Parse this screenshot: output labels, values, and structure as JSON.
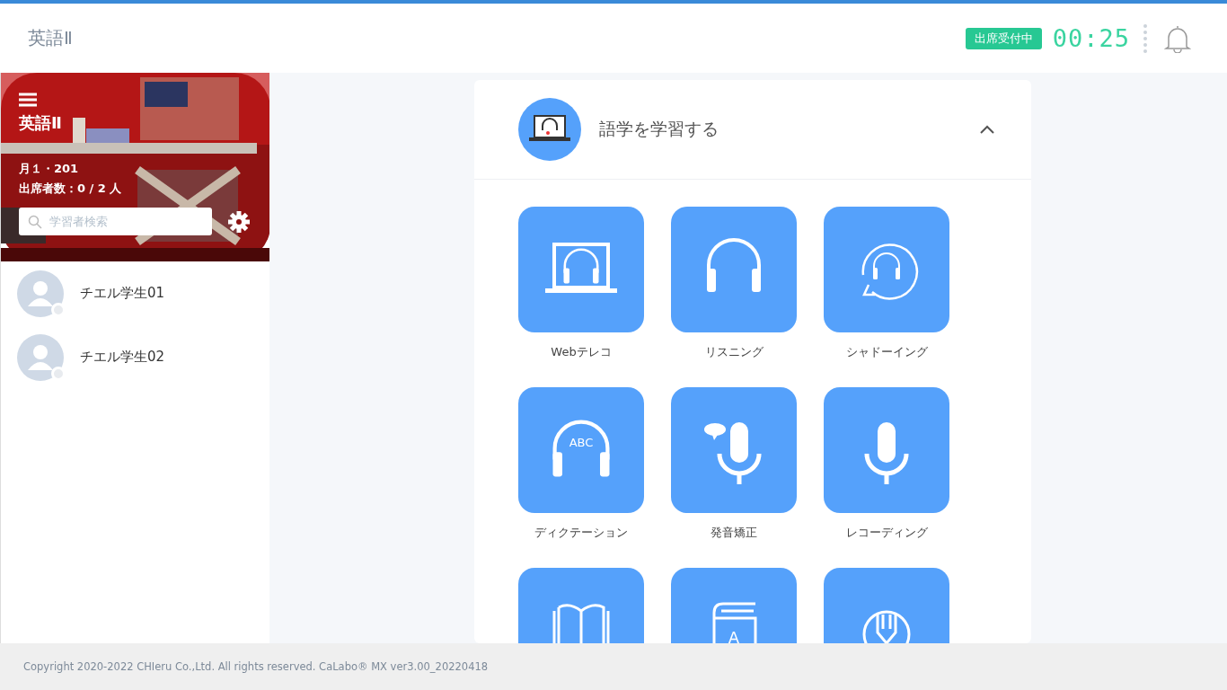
{
  "header": {
    "title": "英語Ⅱ",
    "status_badge": "出席受付中",
    "timer": "00:25"
  },
  "class_panel": {
    "title": "英語Ⅱ",
    "schedule": "月１・201",
    "attendance": "出席者数：0 / 2 人",
    "search": {
      "placeholder": "学習者検索"
    }
  },
  "students": [
    {
      "name": "チエル学生01",
      "online": false
    },
    {
      "name": "チエル学生02",
      "online": false
    }
  ],
  "section": {
    "title": "語学を学習する",
    "expanded": true
  },
  "tiles": [
    {
      "kind": "laptop-headphones",
      "label": "Webテレコ"
    },
    {
      "kind": "headphones",
      "label": "リスニング"
    },
    {
      "kind": "headphones-cycle",
      "label": "シャドーイング"
    },
    {
      "kind": "abc-headphones",
      "label": "ディクテーション",
      "icon_text": "ABC"
    },
    {
      "kind": "mic-bubble",
      "label": "発音矯正"
    },
    {
      "kind": "mic",
      "label": "レコーディング"
    },
    {
      "kind": "book"
    },
    {
      "kind": "dictionary",
      "icon_text": "A"
    },
    {
      "kind": "pencil-globe"
    }
  ],
  "footer": "Copyright 2020-2022 CHIeru Co.,Ltd. All rights reserved. CaLabo® MX ver3.00_20220418"
}
